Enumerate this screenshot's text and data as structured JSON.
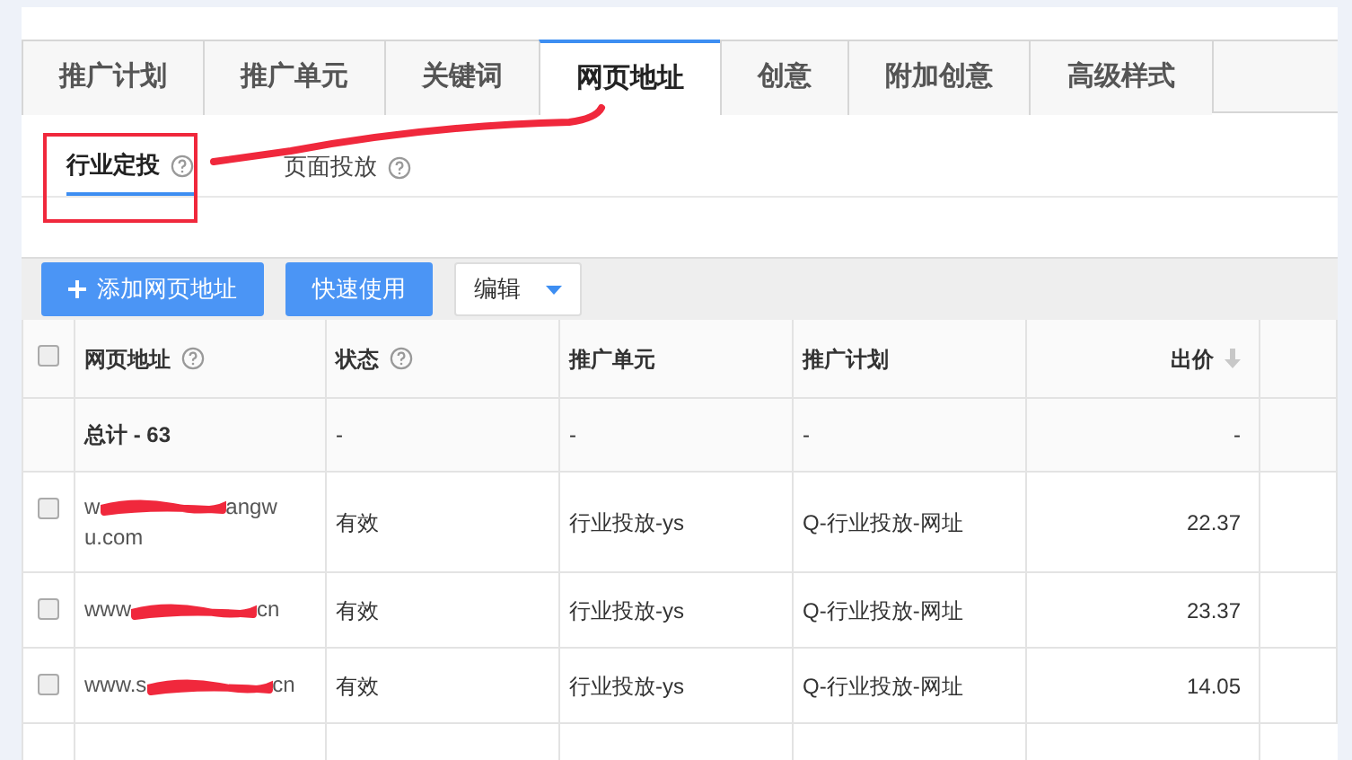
{
  "tabs": [
    {
      "label": "推广计划",
      "selected": false
    },
    {
      "label": "推广单元",
      "selected": false
    },
    {
      "label": "关键词",
      "selected": false
    },
    {
      "label": "网页地址",
      "selected": true
    },
    {
      "label": "创意",
      "selected": false
    },
    {
      "label": "附加创意",
      "selected": false
    },
    {
      "label": "高级样式",
      "selected": false
    }
  ],
  "subtabs": [
    {
      "label": "行业定投",
      "selected": true
    },
    {
      "label": "页面投放",
      "selected": false
    }
  ],
  "toolbar": [
    {
      "label": "添加网页地址",
      "kind": "add"
    },
    {
      "label": "快速使用",
      "kind": "primary"
    },
    {
      "label": "编辑",
      "kind": "dropdown"
    }
  ],
  "table": {
    "header_checked": false,
    "columns": [
      {
        "label": "网页地址",
        "help": true,
        "sort": false
      },
      {
        "label": "状态",
        "help": true,
        "sort": false
      },
      {
        "label": "推广单元",
        "help": false,
        "sort": false
      },
      {
        "label": "推广计划",
        "help": false,
        "sort": false
      },
      {
        "label": "出价",
        "help": false,
        "sort": true
      }
    ],
    "total": {
      "label": "总计 - 63",
      "cells": [
        "-",
        "-",
        "-",
        "-"
      ]
    },
    "rows": [
      {
        "checked": false,
        "url_lines": [
          [
            "w",
            "angw"
          ],
          [
            "u.com"
          ]
        ],
        "status": "有效",
        "unit": "行业投放-ys",
        "plan": "Q-行业投放-网址",
        "price": "22.37"
      },
      {
        "checked": false,
        "url_lines": [
          [
            "www",
            "cn"
          ]
        ],
        "status": "有效",
        "unit": "行业投放-ys",
        "plan": "Q-行业投放-网址",
        "price": "23.37"
      },
      {
        "checked": false,
        "url_lines": [
          [
            "www.s",
            "cn"
          ]
        ],
        "status": "有效",
        "unit": "行业投放-ys",
        "plan": "Q-行业投放-网址",
        "price": "14.05"
      }
    ]
  }
}
